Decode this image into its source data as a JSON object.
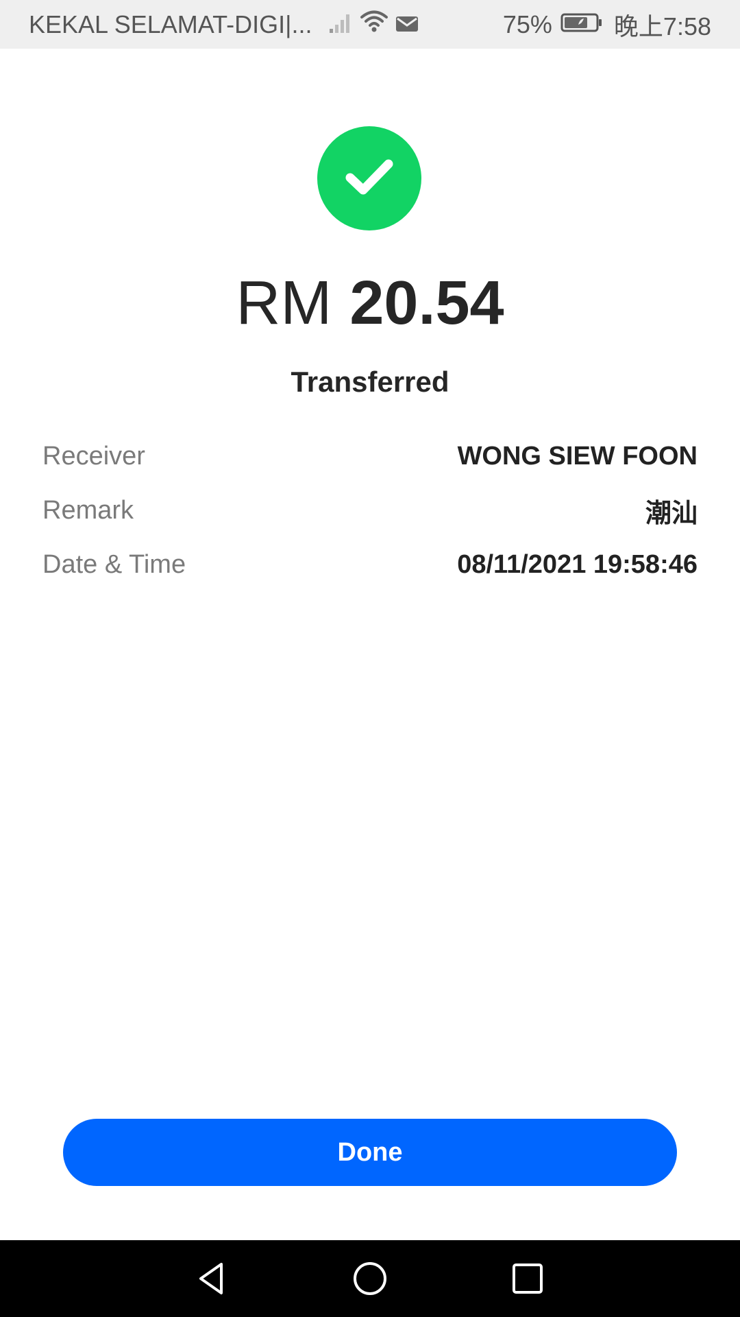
{
  "status_bar": {
    "carrier": "KEKAL SELAMAT-DIGI|...",
    "icons": [
      "signal-icon",
      "wifi-icon",
      "message-icon"
    ],
    "battery_percent": "75%",
    "battery_icon": "battery-icon",
    "time": "晚上7:58"
  },
  "result": {
    "icon": "check-icon",
    "icon_color": "#12d364",
    "currency": "RM",
    "amount": "20.54",
    "status": "Transferred"
  },
  "details": [
    {
      "label": "Receiver",
      "value": "WONG SIEW FOON"
    },
    {
      "label": "Remark",
      "value": "潮汕"
    },
    {
      "label": "Date & Time",
      "value": "08/11/2021 19:58:46"
    }
  ],
  "actions": {
    "done_label": "Done",
    "accent_color": "#0066ff"
  },
  "nav_bar": {
    "buttons": [
      "back-icon",
      "home-icon",
      "recents-icon"
    ]
  }
}
